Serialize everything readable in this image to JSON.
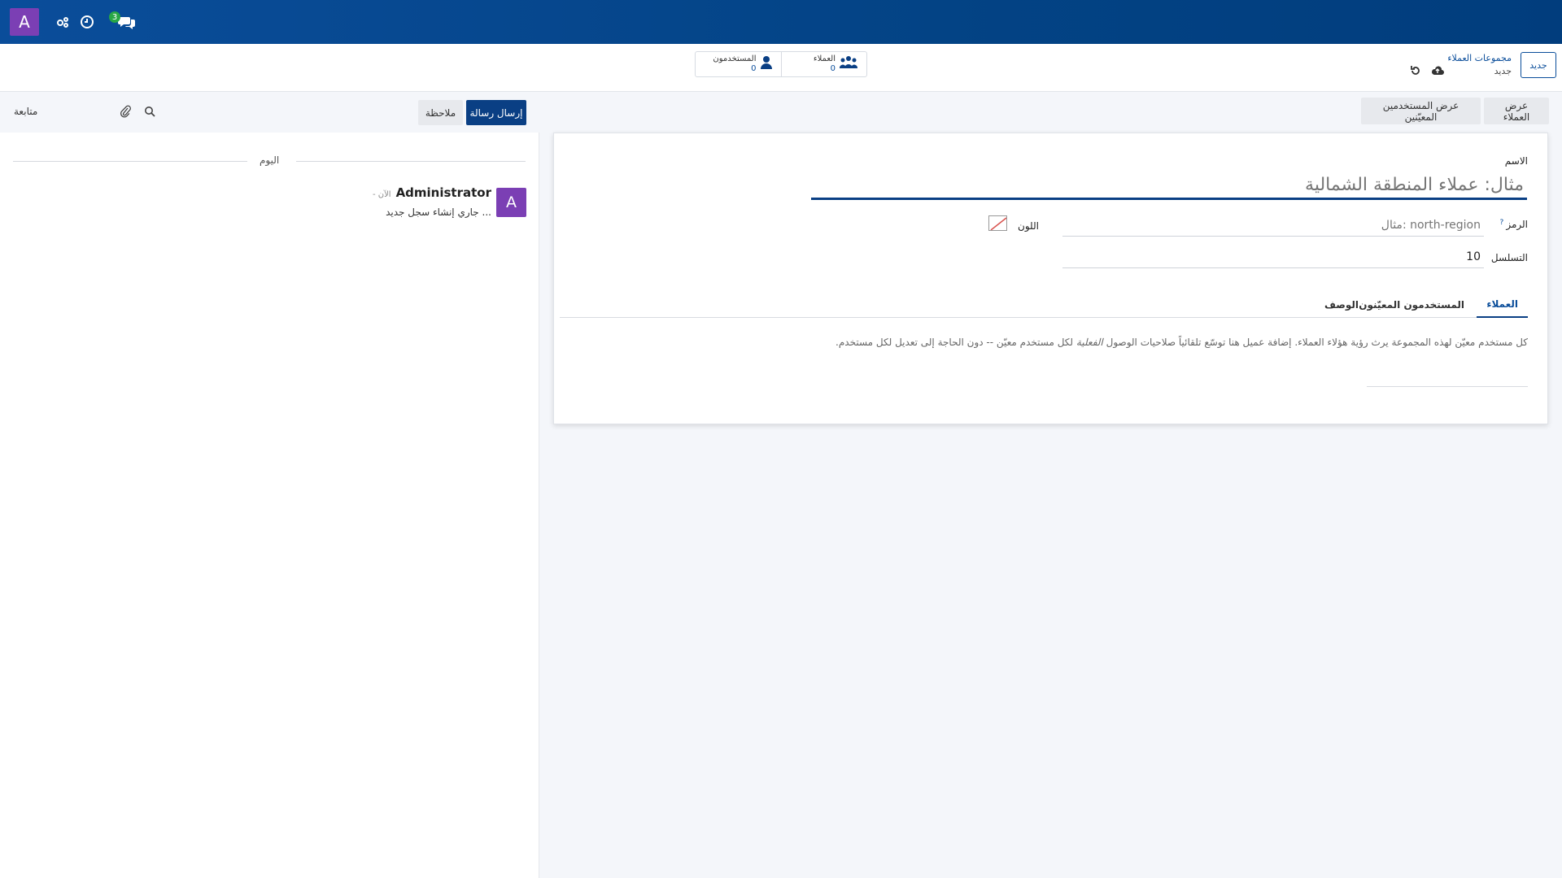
{
  "topbar": {
    "avatar_letter": "A",
    "messages_badge": "3",
    "icons": [
      "activity-icon",
      "clock-icon",
      "chat-icon"
    ]
  },
  "controlbar": {
    "new_button": "جديد",
    "breadcrumb_parent": "مجموعات العملاء",
    "breadcrumb_current": "جديد",
    "stats": [
      {
        "label": "العملاء",
        "value": "0"
      },
      {
        "label": "المستخدمون",
        "value": "0"
      }
    ]
  },
  "form_actions": {
    "show_customers": "عرض العملاء",
    "show_assigned_users": "عرض المستخدمين المعيّنين"
  },
  "form": {
    "name_label": "الاسم",
    "name_placeholder": "مثال: عملاء المنطقة الشمالية",
    "code_label": "الرمز",
    "code_help_mark": "?",
    "code_placeholder": "مثال: north-region",
    "color_label": "اللون",
    "sequence_label": "التسلسل",
    "sequence_value": "10",
    "tabs": [
      {
        "label": "العملاء",
        "active": true
      },
      {
        "label": "المستخدمون المعيّنون",
        "active": false
      },
      {
        "label": "الوصف",
        "active": false
      }
    ],
    "help_part1": "كل مستخدم معيّن لهذه المجموعة يرث رؤية هؤلاء العملاء. إضافة عميل هنا توسّع تلقائياً صلاحيات الوصول ",
    "help_emph": "الفعلية",
    "help_part2": " لكل مستخدم معيّن -- دون الحاجة إلى تعديل لكل مستخدم."
  },
  "chatter": {
    "send_message": "إرسال رسالة",
    "log_note": "ملاحظة",
    "follow": "متابعة",
    "date_separator": "اليوم",
    "message": {
      "avatar_letter": "A",
      "author": "Administrator",
      "time": "- الآن",
      "body": "جاري إنشاء سجل جديد ..."
    }
  }
}
